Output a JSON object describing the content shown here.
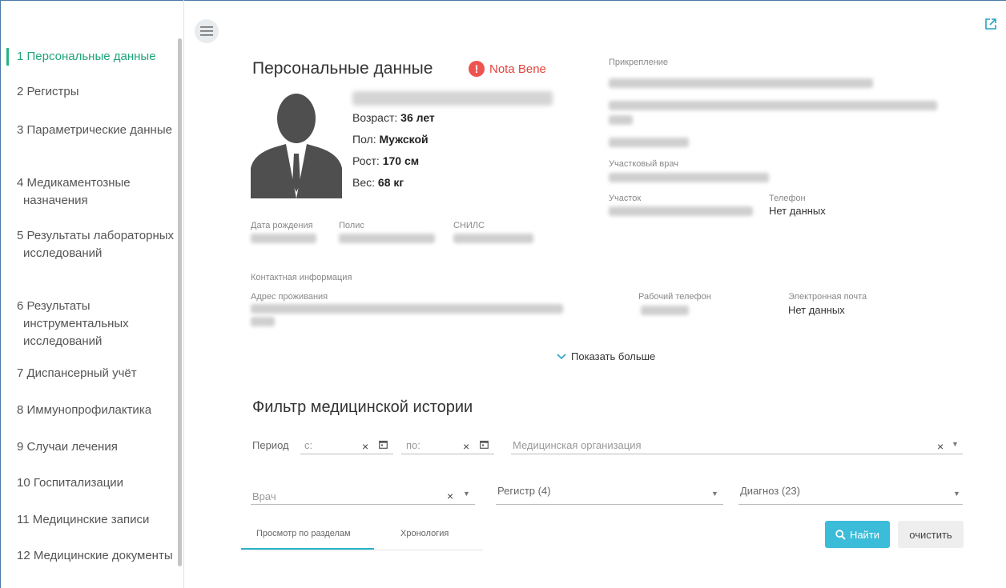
{
  "sidebar": {
    "items": [
      {
        "label": "1  Персональные данные"
      },
      {
        "label": "2  Регистры"
      },
      {
        "label": "3  Параметрические данные"
      },
      {
        "label": "4  Медикаментозные назначения"
      },
      {
        "label": "5  Результаты лабораторных исследований"
      },
      {
        "label": "6  Результаты инструментальных исследований"
      },
      {
        "label": "7  Диспансерный учёт"
      },
      {
        "label": "8  Иммунопрофилактика"
      },
      {
        "label": "9  Случаи лечения"
      },
      {
        "label": "10  Госпитализации"
      },
      {
        "label": "11  Медицинские записи"
      },
      {
        "label": "12  Медицинские документы"
      }
    ],
    "active_index": 0
  },
  "personal": {
    "title": "Персональные данные",
    "nota_bene": "Nota Bene",
    "age_label": "Возраст:",
    "age_value": "36 лет",
    "sex_label": "Пол:",
    "sex_value": "Мужской",
    "height_label": "Рост:",
    "height_value": "170 см",
    "weight_label": "Вес:",
    "weight_value": "68 кг",
    "birth_label": "Дата рождения",
    "policy_label": "Полис",
    "snils_label": "СНИЛС"
  },
  "attachment": {
    "label": "Прикрепление",
    "doctor_label": "Участковый врач",
    "district_label": "Участок",
    "phone_label": "Телефон",
    "phone_value": "Нет данных"
  },
  "contacts": {
    "label": "Контактная информация",
    "address_label": "Адрес проживания",
    "work_phone_label": "Рабочий телефон",
    "email_label": "Электронная почта",
    "email_value": "Нет данных",
    "show_more": "Показать больше"
  },
  "filter": {
    "title": "Фильтр медицинской истории",
    "period_label": "Период",
    "from_label": "с:",
    "to_label": "по:",
    "org_placeholder": "Медицинская организация",
    "doctor_placeholder": "Врач",
    "register_label": "Регистр (4)",
    "diagnosis_label": "Диагноз (23)"
  },
  "tabs": [
    {
      "label": "Просмотр по разделам"
    },
    {
      "label": "Хронология"
    }
  ],
  "buttons": {
    "search": "Найти",
    "clear": "очистить"
  },
  "colors": {
    "accent_green": "#25b47e",
    "accent_blue": "#3bbcd8",
    "nota_red": "#ef5350"
  }
}
